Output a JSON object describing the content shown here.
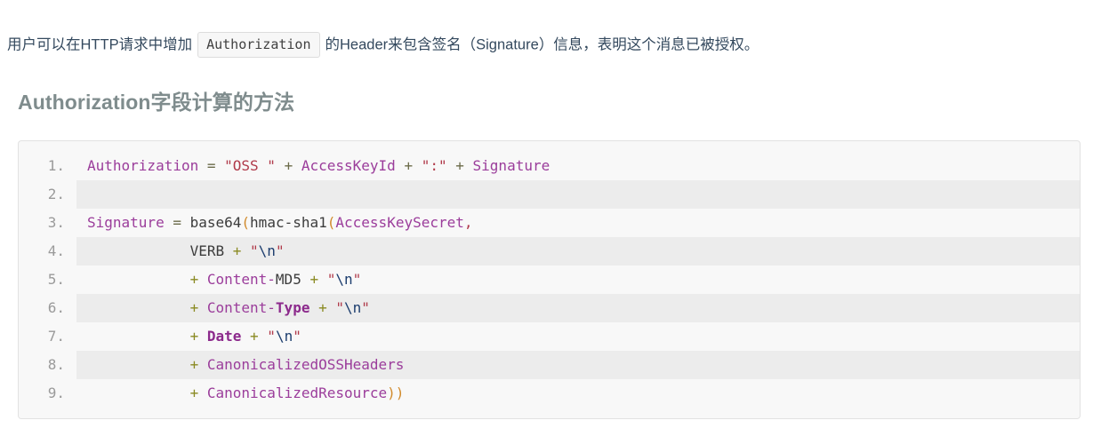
{
  "intro": {
    "before": "用户可以在HTTP请求中增加",
    "inline_code": "Authorization",
    "after": "的Header来包含签名（Signature）信息，表明这个消息已被授权。"
  },
  "heading": {
    "text": "Authorization字段计算的方法"
  },
  "code_block": {
    "language": "plaintext",
    "lines": [
      {
        "number": "1.",
        "striped": false,
        "tokens": [
          {
            "text": "Authorization",
            "cls": "t-name"
          },
          {
            "text": " = ",
            "cls": "t-op"
          },
          {
            "text": "\"OSS \"",
            "cls": "t-str"
          },
          {
            "text": " + ",
            "cls": "t-op"
          },
          {
            "text": "AccessKeyId",
            "cls": "t-name"
          },
          {
            "text": " + ",
            "cls": "t-op"
          },
          {
            "text": "\":\"",
            "cls": "t-str"
          },
          {
            "text": " + ",
            "cls": "t-op"
          },
          {
            "text": "Signature",
            "cls": "t-name"
          }
        ]
      },
      {
        "number": "2.",
        "striped": true,
        "tokens": []
      },
      {
        "number": "3.",
        "striped": false,
        "tokens": [
          {
            "text": "Signature",
            "cls": "t-name"
          },
          {
            "text": " = ",
            "cls": "t-op"
          },
          {
            "text": "base64",
            "cls": "t-fn"
          },
          {
            "text": "(",
            "cls": "t-punc"
          },
          {
            "text": "hmac-sha1",
            "cls": "t-fn"
          },
          {
            "text": "(",
            "cls": "t-punc"
          },
          {
            "text": "AccessKeySecret",
            "cls": "t-name"
          },
          {
            "text": ",",
            "cls": "t-str"
          }
        ]
      },
      {
        "number": "4.",
        "striped": true,
        "tokens": [
          {
            "text": "            ",
            "cls": "t-plain"
          },
          {
            "text": "VERB",
            "cls": "t-plain"
          },
          {
            "text": " + ",
            "cls": "t-plus"
          },
          {
            "text": "\"",
            "cls": "t-str"
          },
          {
            "text": "\\n",
            "cls": "t-esc"
          },
          {
            "text": "\"",
            "cls": "t-str"
          }
        ]
      },
      {
        "number": "5.",
        "striped": false,
        "tokens": [
          {
            "text": "            ",
            "cls": "t-plain"
          },
          {
            "text": "+ ",
            "cls": "t-plus"
          },
          {
            "text": "Content-",
            "cls": "t-name"
          },
          {
            "text": "MD5",
            "cls": "t-plain"
          },
          {
            "text": " + ",
            "cls": "t-plus"
          },
          {
            "text": "\"",
            "cls": "t-str"
          },
          {
            "text": "\\n",
            "cls": "t-esc"
          },
          {
            "text": "\"",
            "cls": "t-str"
          }
        ]
      },
      {
        "number": "6.",
        "striped": true,
        "tokens": [
          {
            "text": "            ",
            "cls": "t-plain"
          },
          {
            "text": "+ ",
            "cls": "t-plus"
          },
          {
            "text": "Content-",
            "cls": "t-name"
          },
          {
            "text": "Type",
            "cls": "t-name-b"
          },
          {
            "text": " + ",
            "cls": "t-plus"
          },
          {
            "text": "\"",
            "cls": "t-str"
          },
          {
            "text": "\\n",
            "cls": "t-esc"
          },
          {
            "text": "\"",
            "cls": "t-str"
          }
        ]
      },
      {
        "number": "7.",
        "striped": false,
        "tokens": [
          {
            "text": "            ",
            "cls": "t-plain"
          },
          {
            "text": "+ ",
            "cls": "t-plus"
          },
          {
            "text": "Date",
            "cls": "t-name-b"
          },
          {
            "text": " + ",
            "cls": "t-plus"
          },
          {
            "text": "\"",
            "cls": "t-str"
          },
          {
            "text": "\\n",
            "cls": "t-esc"
          },
          {
            "text": "\"",
            "cls": "t-str"
          }
        ]
      },
      {
        "number": "8.",
        "striped": true,
        "tokens": [
          {
            "text": "            ",
            "cls": "t-plain"
          },
          {
            "text": "+ ",
            "cls": "t-plus"
          },
          {
            "text": "CanonicalizedOSSHeaders",
            "cls": "t-name"
          }
        ]
      },
      {
        "number": "9.",
        "striped": false,
        "tokens": [
          {
            "text": "            ",
            "cls": "t-plain"
          },
          {
            "text": "+ ",
            "cls": "t-plus"
          },
          {
            "text": "CanonicalizedResource",
            "cls": "t-name"
          },
          {
            "text": "))",
            "cls": "t-punc"
          }
        ]
      }
    ]
  },
  "colors": {
    "text": "#34495e",
    "heading": "#7f8c8d",
    "code_bg": "#f8f8f8",
    "code_border": "#e2e2e2",
    "stripe": "#ececec",
    "line_number": "#9a9a9a",
    "token_name": "#9b3d9b",
    "token_string": "#b03a4a",
    "token_escape": "#1c3d6e",
    "token_paren": "#d18a2b",
    "token_operator": "#8a8a22"
  }
}
